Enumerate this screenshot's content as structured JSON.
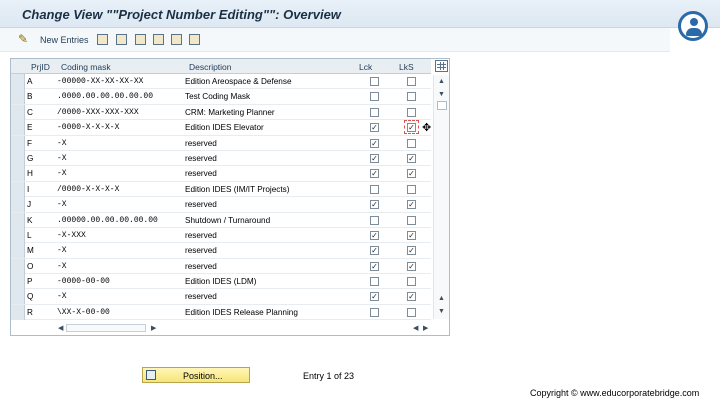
{
  "window": {
    "title": "Change View \"\"Project Number Editing\"\": Overview"
  },
  "toolbar": {
    "new_entries_label": "New Entries"
  },
  "table": {
    "columns": [
      "PrjID",
      "Coding mask",
      "Description",
      "Lck",
      "LkS"
    ],
    "rows": [
      {
        "id": "A",
        "mask": "-00000-XX-XX-XX-XX",
        "desc": "Edition Areospace & Defense",
        "lck": "",
        "lks": ""
      },
      {
        "id": "B",
        "mask": ".0000.00.00.00.00.00",
        "desc": "Test Coding Mask",
        "lck": "",
        "lks": ""
      },
      {
        "id": "C",
        "mask": "/0000-XXX-XXX-XXX",
        "desc": "CRM: Marketing Planner",
        "lck": "",
        "lks": ""
      },
      {
        "id": "E",
        "mask": "-0000-X-X-X-X",
        "desc": "Edition IDES Elevator",
        "lck": "✓",
        "lks": "✓"
      },
      {
        "id": "F",
        "mask": "-X",
        "desc": "reserved",
        "lck": "✓",
        "lks": ""
      },
      {
        "id": "G",
        "mask": "-X",
        "desc": "reserved",
        "lck": "✓",
        "lks": "✓"
      },
      {
        "id": "H",
        "mask": "-X",
        "desc": "reserved",
        "lck": "✓",
        "lks": "✓"
      },
      {
        "id": "I",
        "mask": "/0000-X-X-X-X",
        "desc": "Edition IDES (IM/IT Projects)",
        "lck": "",
        "lks": ""
      },
      {
        "id": "J",
        "mask": "-X",
        "desc": "reserved",
        "lck": "✓",
        "lks": "✓"
      },
      {
        "id": "K",
        "mask": ".00000.00.00.00.00.00",
        "desc": "Shutdown / Turnaround",
        "lck": "",
        "lks": ""
      },
      {
        "id": "L",
        "mask": "-X-XXX",
        "desc": "reserved",
        "lck": "✓",
        "lks": "✓"
      },
      {
        "id": "M",
        "mask": "-X",
        "desc": "reserved",
        "lck": "✓",
        "lks": "✓"
      },
      {
        "id": "O",
        "mask": "-X",
        "desc": "reserved",
        "lck": "✓",
        "lks": "✓"
      },
      {
        "id": "P",
        "mask": "-0000-00-00",
        "desc": "Edition IDES (LDM)",
        "lck": "",
        "lks": ""
      },
      {
        "id": "Q",
        "mask": "-X",
        "desc": "reserved",
        "lck": "✓",
        "lks": "✓"
      },
      {
        "id": "R",
        "mask": "\\XX-X-00-00",
        "desc": "Edition IDES Release Planning",
        "lck": "",
        "lks": ""
      }
    ]
  },
  "footer": {
    "position_label": "Position...",
    "entry_info": "Entry 1 of 23",
    "copyright": "Copyright © www.educorporatebridge.com"
  },
  "icons": {
    "edit": "✎",
    "scroll_up": "▲",
    "scroll_down": "▼",
    "scroll_left": "◀",
    "scroll_right": "▶",
    "move_cursor": "✥"
  },
  "colors": {
    "accent": "#2b6aa8",
    "button": "#f5e57a",
    "focus": "#d9534f"
  }
}
